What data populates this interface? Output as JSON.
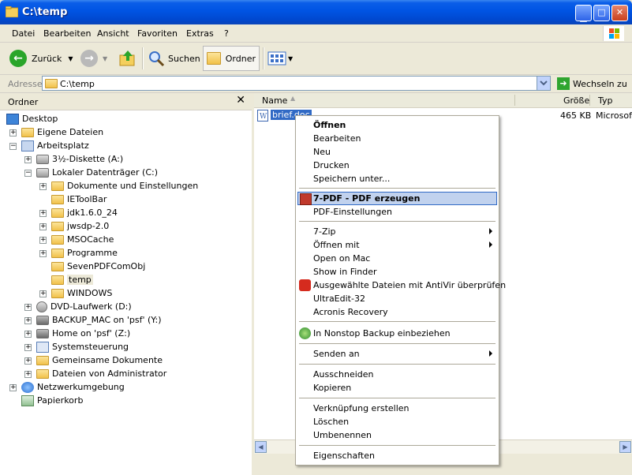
{
  "window": {
    "title": "C:\\temp"
  },
  "menu": [
    "Datei",
    "Bearbeiten",
    "Ansicht",
    "Favoriten",
    "Extras",
    "?"
  ],
  "toolbar": {
    "back": "Zurück",
    "search": "Suchen",
    "folders": "Ordner"
  },
  "address": {
    "label": "Adresse",
    "path": "C:\\temp",
    "go": "Wechseln zu"
  },
  "folders_pane": {
    "title": "Ordner",
    "close": "✕"
  },
  "tree": [
    {
      "label": "Desktop"
    },
    {
      "label": "Eigene Dateien"
    },
    {
      "label": "Arbeitsplatz"
    },
    {
      "label": "3½-Diskette (A:)"
    },
    {
      "label": "Lokaler Datenträger (C:)"
    },
    {
      "label": "Dokumente und Einstellungen"
    },
    {
      "label": "IEToolBar"
    },
    {
      "label": "jdk1.6.0_24"
    },
    {
      "label": "jwsdp-2.0"
    },
    {
      "label": "MSOCache"
    },
    {
      "label": "Programme"
    },
    {
      "label": "SevenPDFComObj"
    },
    {
      "label": "temp"
    },
    {
      "label": "WINDOWS"
    },
    {
      "label": "DVD-Laufwerk (D:)"
    },
    {
      "label": "BACKUP_MAC on 'psf' (Y:)"
    },
    {
      "label": "Home on 'psf' (Z:)"
    },
    {
      "label": "Systemsteuerung"
    },
    {
      "label": "Gemeinsame Dokumente"
    },
    {
      "label": "Dateien von Administrator"
    },
    {
      "label": "Netzwerkumgebung"
    },
    {
      "label": "Papierkorb"
    }
  ],
  "columns": {
    "name": "Name",
    "size": "Größe",
    "type": "Typ"
  },
  "files": [
    {
      "name": "brief.doc",
      "size": "465 KB",
      "type": "Microsoft"
    }
  ],
  "context_menu": [
    {
      "label": "Öffnen"
    },
    {
      "label": "Bearbeiten"
    },
    {
      "label": "Neu"
    },
    {
      "label": "Drucken"
    },
    {
      "label": "Speichern unter..."
    },
    {
      "label": "7-PDF - PDF erzeugen"
    },
    {
      "label": "PDF-Einstellungen"
    },
    {
      "label": "7-Zip"
    },
    {
      "label": "Öffnen mit"
    },
    {
      "label": "Open on Mac"
    },
    {
      "label": "Show in Finder"
    },
    {
      "label": "Ausgewählte Dateien mit AntiVir überprüfen"
    },
    {
      "label": "UltraEdit-32"
    },
    {
      "label": "Acronis Recovery"
    },
    {
      "label": "In Nonstop Backup einbeziehen"
    },
    {
      "label": "Senden an"
    },
    {
      "label": "Ausschneiden"
    },
    {
      "label": "Kopieren"
    },
    {
      "label": "Verknüpfung erstellen"
    },
    {
      "label": "Löschen"
    },
    {
      "label": "Umbenennen"
    },
    {
      "label": "Eigenschaften"
    }
  ],
  "colors": {
    "titlebar": "#0054e3",
    "selection": "#316ac5",
    "menu_highlight": "#c1d2ee",
    "window_bg": "#ece9d8"
  }
}
